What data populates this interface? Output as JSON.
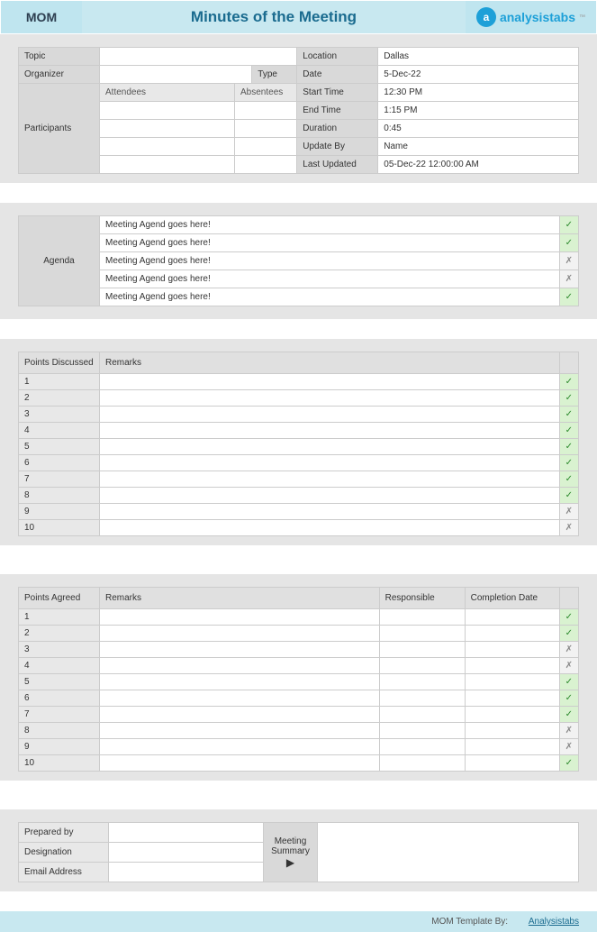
{
  "header": {
    "mom": "MOM",
    "title": "Minutes of the Meeting",
    "logo_text": "analysistabs",
    "logo_tm": "™"
  },
  "info": {
    "topic_label": "Topic",
    "topic": "",
    "location_label": "Location",
    "location": "Dallas",
    "organizer_label": "Organizer",
    "organizer": "",
    "type_label": "Type",
    "type": "",
    "date_label": "Date",
    "date": "5-Dec-22",
    "participants_label": "Participants",
    "attendees_label": "Attendees",
    "absentees_label": "Absentees",
    "start_time_label": "Start Time",
    "start_time": "12:30 PM",
    "end_time_label": "End Time",
    "end_time": "1:15 PM",
    "duration_label": "Duration",
    "duration": "0:45",
    "update_by_label": "Update By",
    "update_by": "Name",
    "last_updated_label": "Last Updated",
    "last_updated": "05-Dec-22 12:00:00 AM"
  },
  "agenda": {
    "label": "Agenda",
    "items": [
      {
        "text": "Meeting Agend goes here!",
        "ok": true
      },
      {
        "text": "Meeting Agend goes here!",
        "ok": true
      },
      {
        "text": "Meeting Agend goes here!",
        "ok": false
      },
      {
        "text": "Meeting Agend goes here!",
        "ok": false
      },
      {
        "text": "Meeting Agend goes here!",
        "ok": true
      }
    ]
  },
  "points_discussed": {
    "header1": "Points Discussed",
    "header2": "Remarks",
    "rows": [
      {
        "n": "1",
        "remarks": "",
        "ok": true
      },
      {
        "n": "2",
        "remarks": "",
        "ok": true
      },
      {
        "n": "3",
        "remarks": "",
        "ok": true
      },
      {
        "n": "4",
        "remarks": "",
        "ok": true
      },
      {
        "n": "5",
        "remarks": "",
        "ok": true
      },
      {
        "n": "6",
        "remarks": "",
        "ok": true
      },
      {
        "n": "7",
        "remarks": "",
        "ok": true
      },
      {
        "n": "8",
        "remarks": "",
        "ok": true
      },
      {
        "n": "9",
        "remarks": "",
        "ok": false
      },
      {
        "n": "10",
        "remarks": "",
        "ok": false
      }
    ]
  },
  "points_agreed": {
    "header1": "Points Agreed",
    "header2": "Remarks",
    "header3": "Responsible",
    "header4": "Completion Date",
    "rows": [
      {
        "n": "1",
        "remarks": "",
        "responsible": "",
        "date": "",
        "ok": true
      },
      {
        "n": "2",
        "remarks": "",
        "responsible": "",
        "date": "",
        "ok": true
      },
      {
        "n": "3",
        "remarks": "",
        "responsible": "",
        "date": "",
        "ok": false
      },
      {
        "n": "4",
        "remarks": "",
        "responsible": "",
        "date": "",
        "ok": false
      },
      {
        "n": "5",
        "remarks": "",
        "responsible": "",
        "date": "",
        "ok": true
      },
      {
        "n": "6",
        "remarks": "",
        "responsible": "",
        "date": "",
        "ok": true
      },
      {
        "n": "7",
        "remarks": "",
        "responsible": "",
        "date": "",
        "ok": true
      },
      {
        "n": "8",
        "remarks": "",
        "responsible": "",
        "date": "",
        "ok": false
      },
      {
        "n": "9",
        "remarks": "",
        "responsible": "",
        "date": "",
        "ok": false
      },
      {
        "n": "10",
        "remarks": "",
        "responsible": "",
        "date": "",
        "ok": true
      }
    ]
  },
  "footer": {
    "prepared_by_label": "Prepared by",
    "prepared_by": "",
    "designation_label": "Designation",
    "designation": "",
    "email_label": "Email Address",
    "email": "",
    "summary_label": "Meeting Summary"
  },
  "bottom": {
    "text": "MOM Template By:",
    "link": "Analysistabs"
  }
}
